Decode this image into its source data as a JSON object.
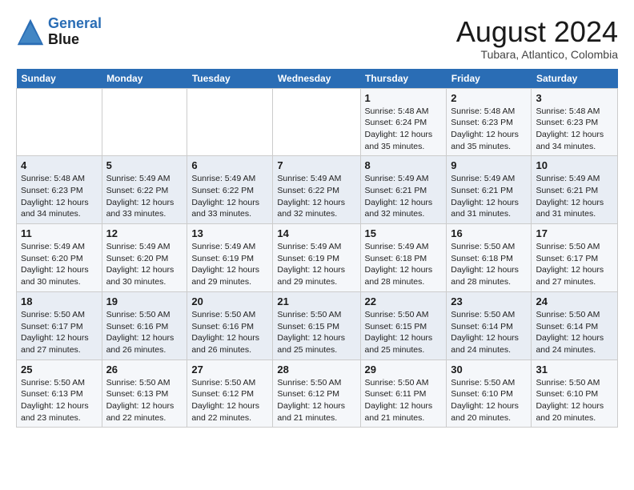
{
  "header": {
    "logo_line1": "General",
    "logo_line2": "Blue",
    "month_year": "August 2024",
    "location": "Tubara, Atlantico, Colombia"
  },
  "weekdays": [
    "Sunday",
    "Monday",
    "Tuesday",
    "Wednesday",
    "Thursday",
    "Friday",
    "Saturday"
  ],
  "weeks": [
    [
      {
        "num": "",
        "info": ""
      },
      {
        "num": "",
        "info": ""
      },
      {
        "num": "",
        "info": ""
      },
      {
        "num": "",
        "info": ""
      },
      {
        "num": "1",
        "info": "Sunrise: 5:48 AM\nSunset: 6:24 PM\nDaylight: 12 hours\nand 35 minutes."
      },
      {
        "num": "2",
        "info": "Sunrise: 5:48 AM\nSunset: 6:23 PM\nDaylight: 12 hours\nand 35 minutes."
      },
      {
        "num": "3",
        "info": "Sunrise: 5:48 AM\nSunset: 6:23 PM\nDaylight: 12 hours\nand 34 minutes."
      }
    ],
    [
      {
        "num": "4",
        "info": "Sunrise: 5:48 AM\nSunset: 6:23 PM\nDaylight: 12 hours\nand 34 minutes."
      },
      {
        "num": "5",
        "info": "Sunrise: 5:49 AM\nSunset: 6:22 PM\nDaylight: 12 hours\nand 33 minutes."
      },
      {
        "num": "6",
        "info": "Sunrise: 5:49 AM\nSunset: 6:22 PM\nDaylight: 12 hours\nand 33 minutes."
      },
      {
        "num": "7",
        "info": "Sunrise: 5:49 AM\nSunset: 6:22 PM\nDaylight: 12 hours\nand 32 minutes."
      },
      {
        "num": "8",
        "info": "Sunrise: 5:49 AM\nSunset: 6:21 PM\nDaylight: 12 hours\nand 32 minutes."
      },
      {
        "num": "9",
        "info": "Sunrise: 5:49 AM\nSunset: 6:21 PM\nDaylight: 12 hours\nand 31 minutes."
      },
      {
        "num": "10",
        "info": "Sunrise: 5:49 AM\nSunset: 6:21 PM\nDaylight: 12 hours\nand 31 minutes."
      }
    ],
    [
      {
        "num": "11",
        "info": "Sunrise: 5:49 AM\nSunset: 6:20 PM\nDaylight: 12 hours\nand 30 minutes."
      },
      {
        "num": "12",
        "info": "Sunrise: 5:49 AM\nSunset: 6:20 PM\nDaylight: 12 hours\nand 30 minutes."
      },
      {
        "num": "13",
        "info": "Sunrise: 5:49 AM\nSunset: 6:19 PM\nDaylight: 12 hours\nand 29 minutes."
      },
      {
        "num": "14",
        "info": "Sunrise: 5:49 AM\nSunset: 6:19 PM\nDaylight: 12 hours\nand 29 minutes."
      },
      {
        "num": "15",
        "info": "Sunrise: 5:49 AM\nSunset: 6:18 PM\nDaylight: 12 hours\nand 28 minutes."
      },
      {
        "num": "16",
        "info": "Sunrise: 5:50 AM\nSunset: 6:18 PM\nDaylight: 12 hours\nand 28 minutes."
      },
      {
        "num": "17",
        "info": "Sunrise: 5:50 AM\nSunset: 6:17 PM\nDaylight: 12 hours\nand 27 minutes."
      }
    ],
    [
      {
        "num": "18",
        "info": "Sunrise: 5:50 AM\nSunset: 6:17 PM\nDaylight: 12 hours\nand 27 minutes."
      },
      {
        "num": "19",
        "info": "Sunrise: 5:50 AM\nSunset: 6:16 PM\nDaylight: 12 hours\nand 26 minutes."
      },
      {
        "num": "20",
        "info": "Sunrise: 5:50 AM\nSunset: 6:16 PM\nDaylight: 12 hours\nand 26 minutes."
      },
      {
        "num": "21",
        "info": "Sunrise: 5:50 AM\nSunset: 6:15 PM\nDaylight: 12 hours\nand 25 minutes."
      },
      {
        "num": "22",
        "info": "Sunrise: 5:50 AM\nSunset: 6:15 PM\nDaylight: 12 hours\nand 25 minutes."
      },
      {
        "num": "23",
        "info": "Sunrise: 5:50 AM\nSunset: 6:14 PM\nDaylight: 12 hours\nand 24 minutes."
      },
      {
        "num": "24",
        "info": "Sunrise: 5:50 AM\nSunset: 6:14 PM\nDaylight: 12 hours\nand 24 minutes."
      }
    ],
    [
      {
        "num": "25",
        "info": "Sunrise: 5:50 AM\nSunset: 6:13 PM\nDaylight: 12 hours\nand 23 minutes."
      },
      {
        "num": "26",
        "info": "Sunrise: 5:50 AM\nSunset: 6:13 PM\nDaylight: 12 hours\nand 22 minutes."
      },
      {
        "num": "27",
        "info": "Sunrise: 5:50 AM\nSunset: 6:12 PM\nDaylight: 12 hours\nand 22 minutes."
      },
      {
        "num": "28",
        "info": "Sunrise: 5:50 AM\nSunset: 6:12 PM\nDaylight: 12 hours\nand 21 minutes."
      },
      {
        "num": "29",
        "info": "Sunrise: 5:50 AM\nSunset: 6:11 PM\nDaylight: 12 hours\nand 21 minutes."
      },
      {
        "num": "30",
        "info": "Sunrise: 5:50 AM\nSunset: 6:10 PM\nDaylight: 12 hours\nand 20 minutes."
      },
      {
        "num": "31",
        "info": "Sunrise: 5:50 AM\nSunset: 6:10 PM\nDaylight: 12 hours\nand 20 minutes."
      }
    ]
  ]
}
